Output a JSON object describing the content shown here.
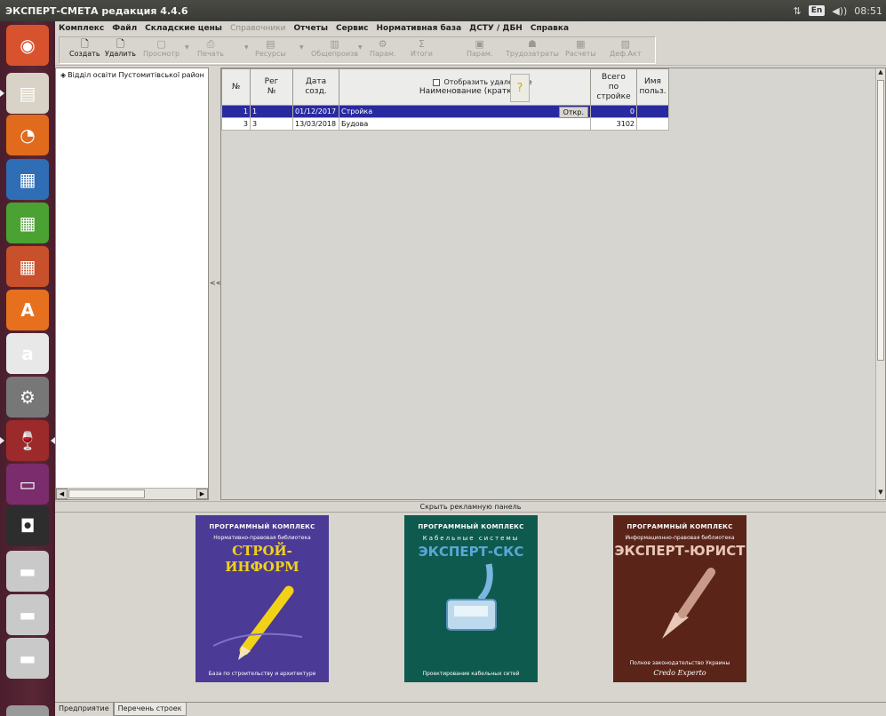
{
  "app": {
    "title": "ЭКСПЕРТ-СМЕТА редакция 4.4.6"
  },
  "tray": {
    "lang": "En",
    "volume": "◀))",
    "time": "08:51",
    "network": "⇅"
  },
  "launcher": {
    "items": [
      {
        "name": "ubuntu-logo-icon",
        "glyph": "◉",
        "color": "#d8532d"
      },
      {
        "name": "files-icon",
        "glyph": "▤",
        "color": "#d9d2c6"
      },
      {
        "name": "firefox-icon",
        "glyph": "◔",
        "color": "#e06b1c"
      },
      {
        "name": "writer-icon",
        "glyph": "▦",
        "color": "#2f6db4"
      },
      {
        "name": "calc-icon",
        "glyph": "▦",
        "color": "#4aa232"
      },
      {
        "name": "impress-icon",
        "glyph": "▦",
        "color": "#c8502a"
      },
      {
        "name": "software-center-icon",
        "glyph": "A",
        "color": "#e7701e"
      },
      {
        "name": "amazon-icon",
        "glyph": "a",
        "color": "#e8e8e8"
      },
      {
        "name": "system-settings-icon",
        "glyph": "⚙",
        "color": "#777777"
      },
      {
        "name": "wine-icon",
        "glyph": "🍷",
        "color": "#9c2a2a"
      },
      {
        "name": "monitor-icon",
        "glyph": "▭",
        "color": "#7a2c6c"
      },
      {
        "name": "usb-device-icon",
        "glyph": "◘",
        "color": "#2d2d2d"
      },
      {
        "name": "drive-icon",
        "glyph": "▬",
        "color": "#c9c9c9"
      },
      {
        "name": "drive-icon",
        "glyph": "▬",
        "color": "#c9c9c9"
      },
      {
        "name": "drive-icon",
        "glyph": "▬",
        "color": "#c9c9c9"
      },
      {
        "name": "trash-icon",
        "glyph": "🗑",
        "color": "#9a9a9a"
      }
    ]
  },
  "menu": {
    "items": [
      {
        "label": "Комплекс",
        "disabled": false
      },
      {
        "label": "Файл",
        "disabled": false
      },
      {
        "label": "Складские цены",
        "disabled": false
      },
      {
        "label": "Справочники",
        "disabled": true
      },
      {
        "label": "Отчеты",
        "disabled": false
      },
      {
        "label": "Сервис",
        "disabled": false
      },
      {
        "label": "Нормативная база",
        "disabled": false
      },
      {
        "label": "ДСТУ / ДБН",
        "disabled": false
      },
      {
        "label": "Справка",
        "disabled": false
      }
    ]
  },
  "toolbar": {
    "create": "Создать",
    "delete": "Удалить",
    "view": "Просмотр",
    "print": "Печать",
    "resources": "Ресурсы",
    "general": "Общепроизв",
    "params": "Парам.",
    "totals": "Итоги",
    "params2": "Парам.",
    "labor": "Трудозатраты",
    "calcs": "Расчеты",
    "defact": "Деф.Акт"
  },
  "tree": {
    "root_label": "Відділ освіти Пустомитівської район"
  },
  "splitter": {
    "label": "<<"
  },
  "grid": {
    "headers": {
      "num": "№",
      "reg": "Рег №",
      "date": "Дата созд.",
      "show_deleted": "Отобразить удаленные",
      "name": "Наименование (краткое)",
      "total": "Всего по стройке",
      "user": "Имя польз."
    },
    "help": "?",
    "open_label": "Откр.",
    "rows": [
      {
        "num": "1",
        "reg": "1",
        "date": "01/12/2017",
        "name": "Стройка",
        "total": "0",
        "user": ""
      },
      {
        "num": "3",
        "reg": "3",
        "date": "13/03/2018",
        "name": "Будова",
        "total": "3102",
        "user": ""
      }
    ]
  },
  "ad_panel": {
    "hide_label": "Скрыть рекламную панель",
    "ads": [
      {
        "header": "ПРОГРАММНЫЙ КОМПЛЕКС",
        "sub": "Нормативно-правовая библиотека",
        "title": "СТРОЙ-ИНФОРМ",
        "footer": "База по строительству и архитектуре",
        "bg": "#4b3a96",
        "accent": "#f2d219"
      },
      {
        "header": "ПРОГРАММНЫЙ КОМПЛЕКС",
        "sub": "Кабельные системы",
        "title": "ЭКСПЕРТ-СКС",
        "footer": "Проектирование кабельных сетей",
        "bg": "#0e5a4e",
        "accent": "#5aa7d6"
      },
      {
        "header": "ПРОГРАММНЫЙ КОМПЛЕКС",
        "sub": "Информационно-правовая библиотека",
        "title": "ЭКСПЕРТ-ЮРИСТ",
        "footer": "Полное законодательство Украины",
        "signature": "Credo Experto",
        "bg": "#5a2418",
        "accent": "#e8c7b8"
      }
    ]
  },
  "tabs": {
    "items": [
      {
        "label": "Предприятие",
        "active": false
      },
      {
        "label": "Перечень строек",
        "active": true
      }
    ]
  }
}
